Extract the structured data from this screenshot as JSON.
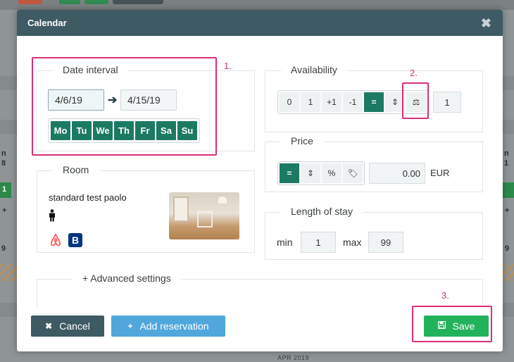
{
  "modal": {
    "title": "Calendar",
    "close_symbol": "✖"
  },
  "date_interval": {
    "legend": "Date interval",
    "start": "4/6/19",
    "end": "4/15/19",
    "days": [
      "Mo",
      "Tu",
      "We",
      "Th",
      "Fr",
      "Sa",
      "Su"
    ]
  },
  "room": {
    "legend": "Room",
    "name": "standard test paolo"
  },
  "availability": {
    "legend": "Availability",
    "options": [
      "0",
      "1",
      "+1",
      "-1",
      "=",
      "⇕",
      "⚖"
    ],
    "active": "=",
    "value": "1"
  },
  "price": {
    "legend": "Price",
    "options": [
      "=",
      "⇕",
      "%",
      "🏷"
    ],
    "active": "=",
    "value": "0.00",
    "currency": "EUR"
  },
  "length_of_stay": {
    "legend": "Length of stay",
    "min_label": "min",
    "min_value": "1",
    "max_label": "max",
    "max_value": "99"
  },
  "advanced": {
    "label": "+  Advanced settings"
  },
  "footer": {
    "cancel_label": "Cancel",
    "add_label": "Add reservation",
    "save_label": "Save"
  },
  "annotations": {
    "one": "1.",
    "two": "2.",
    "three": "3."
  },
  "background": {
    "left_text_1": "n",
    "left_text_2": "8",
    "left_text_3": "1",
    "left_text_4": "+",
    "left_text_5": "9",
    "right_text_1": "n",
    "right_text_2": "1",
    "right_text_3": "+",
    "right_text_4": "9",
    "month": "APR 2019"
  },
  "colors": {
    "header": "#3e5a63",
    "day_green": "#1c7a63",
    "save_green": "#22b25c",
    "add_blue": "#4fa7dc",
    "annotation": "#d92f7a"
  }
}
